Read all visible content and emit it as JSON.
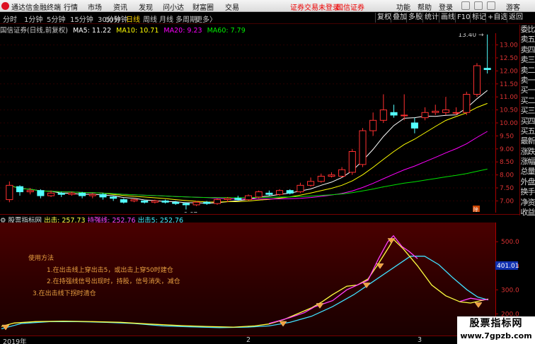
{
  "app": {
    "title": "通达信金融终端"
  },
  "menu": [
    "行情",
    "市场",
    "资讯",
    "发现",
    "问小达",
    "财富圈",
    "交易"
  ],
  "warning": "证券交易未登录",
  "broker": "国信证券",
  "right_menu": [
    "功能",
    "帮助",
    "登录",
    "游客"
  ],
  "periods": [
    "分时",
    "1分钟",
    "5分钟",
    "15分钟",
    "30分钟",
    "60分钟",
    "日线",
    "周线",
    "月线",
    "多周期",
    "更多〉"
  ],
  "active_period": "日线",
  "tools": [
    "复权",
    "叠加",
    "多股",
    "统计",
    "画线",
    "F10",
    "标记",
    "+自选",
    "返回"
  ],
  "upper": {
    "title": "国信证券(日线,前复权)",
    "ma": [
      {
        "label": "MA5: 11.22",
        "color": "#ffffff"
      },
      {
        "label": "MA10: 10.71",
        "color": "#ffff00"
      },
      {
        "label": "MA20: 9.23",
        "color": "#ff00ff"
      },
      {
        "label": "MA60: 7.79",
        "color": "#00e000"
      }
    ],
    "y_ticks": [
      "13.00",
      "12.50",
      "12.00",
      "11.50",
      "11.00",
      "10.50",
      "10.00",
      "9.50",
      "9.00",
      "8.50",
      "8.00",
      "7.50",
      "7.00"
    ],
    "high_label": "13.40",
    "low_label": "6.67",
    "side_label": "除"
  },
  "sidebar": [
    "委比",
    "卖五",
    "卖四",
    "卖三",
    "卖二",
    "卖一",
    "买一",
    "买二",
    "买三",
    "买四",
    "买五",
    "最新",
    "涨跌",
    "涨幅",
    "总量",
    "外盘",
    "换手",
    "净资",
    "收益"
  ],
  "lower": {
    "title": "股票指标网",
    "legend": [
      {
        "label": "出击: 257.73",
        "color": "#ffff40"
      },
      {
        "label": "持强线: 252.76",
        "color": "#ff40ff"
      },
      {
        "label": "出击5: 252.76",
        "color": "#40e0ff"
      }
    ],
    "y_ticks": [
      "500.0",
      "400.0",
      "300.0",
      "200.0"
    ],
    "current_value": "401.01",
    "method": [
      "使用方法",
      "1.在出击线上穿出击5，或出击上穿50时建仓",
      "2.在持强线信号出现时，持股，信号消失，减仓",
      "3.在出击线下拐时清仓"
    ]
  },
  "date_axis": [
    "2019年",
    "2",
    "3"
  ],
  "watermark": {
    "line1": "股票指标网",
    "line2": "www.7gpzb.com"
  },
  "candles": [
    {
      "o": 7.05,
      "c": 7.6,
      "h": 7.75,
      "l": 6.95
    },
    {
      "o": 7.55,
      "c": 7.35,
      "h": 7.6,
      "l": 7.2
    },
    {
      "o": 7.35,
      "c": 7.4,
      "h": 7.5,
      "l": 7.25
    },
    {
      "o": 7.4,
      "c": 7.2,
      "h": 7.45,
      "l": 7.1
    },
    {
      "o": 7.2,
      "c": 7.3,
      "h": 7.4,
      "l": 7.15
    },
    {
      "o": 7.3,
      "c": 7.25,
      "h": 7.35,
      "l": 7.15
    },
    {
      "o": 7.25,
      "c": 7.3,
      "h": 7.35,
      "l": 7.2
    },
    {
      "o": 7.3,
      "c": 7.2,
      "h": 7.35,
      "l": 7.1
    },
    {
      "o": 7.2,
      "c": 7.25,
      "h": 7.3,
      "l": 7.1
    },
    {
      "o": 7.25,
      "c": 7.15,
      "h": 7.3,
      "l": 7.05
    },
    {
      "o": 7.15,
      "c": 7.1,
      "h": 7.2,
      "l": 7.0
    },
    {
      "o": 7.05,
      "c": 6.95,
      "h": 7.1,
      "l": 6.9
    },
    {
      "o": 7.0,
      "c": 7.05,
      "h": 7.1,
      "l": 6.95
    },
    {
      "o": 7.0,
      "c": 6.95,
      "h": 7.05,
      "l": 6.9
    },
    {
      "o": 6.95,
      "c": 7.0,
      "h": 7.05,
      "l": 6.9
    },
    {
      "o": 7.0,
      "c": 6.95,
      "h": 7.05,
      "l": 6.9
    },
    {
      "o": 6.95,
      "c": 6.9,
      "h": 7.0,
      "l": 6.85
    },
    {
      "o": 6.9,
      "c": 6.85,
      "h": 6.95,
      "l": 6.67
    },
    {
      "o": 6.85,
      "c": 6.95,
      "h": 7.0,
      "l": 6.8
    },
    {
      "o": 6.95,
      "c": 6.9,
      "h": 7.0,
      "l": 6.85
    },
    {
      "o": 6.9,
      "c": 7.05,
      "h": 7.1,
      "l": 6.85
    },
    {
      "o": 7.05,
      "c": 7.1,
      "h": 7.15,
      "l": 6.95
    },
    {
      "o": 7.1,
      "c": 7.05,
      "h": 7.2,
      "l": 7.0
    },
    {
      "o": 7.05,
      "c": 7.2,
      "h": 7.25,
      "l": 7.0
    },
    {
      "o": 7.15,
      "c": 7.35,
      "h": 7.4,
      "l": 7.1
    },
    {
      "o": 7.3,
      "c": 7.25,
      "h": 7.4,
      "l": 7.2
    },
    {
      "o": 7.25,
      "c": 7.4,
      "h": 7.45,
      "l": 7.2
    },
    {
      "o": 7.4,
      "c": 7.3,
      "h": 7.45,
      "l": 7.25
    },
    {
      "o": 7.35,
      "c": 7.6,
      "h": 7.7,
      "l": 7.3
    },
    {
      "o": 7.6,
      "c": 7.75,
      "h": 7.9,
      "l": 7.55
    },
    {
      "o": 7.75,
      "c": 7.95,
      "h": 8.05,
      "l": 7.7
    },
    {
      "o": 7.95,
      "c": 8.0,
      "h": 8.1,
      "l": 7.9
    },
    {
      "o": 7.95,
      "c": 8.2,
      "h": 8.3,
      "l": 7.9
    },
    {
      "o": 8.1,
      "c": 8.9,
      "h": 9.0,
      "l": 8.0
    },
    {
      "o": 8.4,
      "c": 9.7,
      "h": 9.8,
      "l": 8.3
    },
    {
      "o": 9.7,
      "c": 10.1,
      "h": 10.4,
      "l": 9.5
    },
    {
      "o": 10.1,
      "c": 10.5,
      "h": 11.1,
      "l": 10.0
    },
    {
      "o": 10.4,
      "c": 10.3,
      "h": 10.7,
      "l": 10.2
    },
    {
      "o": 10.3,
      "c": 10.3,
      "h": 11.1,
      "l": 10.1
    },
    {
      "o": 10.0,
      "c": 9.8,
      "h": 10.2,
      "l": 9.6
    },
    {
      "o": 10.2,
      "c": 10.4,
      "h": 10.6,
      "l": 10.1
    },
    {
      "o": 10.4,
      "c": 10.45,
      "h": 10.7,
      "l": 10.3
    },
    {
      "o": 10.4,
      "c": 10.5,
      "h": 11.0,
      "l": 10.3
    },
    {
      "o": 10.4,
      "c": 10.4,
      "h": 10.6,
      "l": 10.3
    },
    {
      "o": 10.4,
      "c": 11.1,
      "h": 11.2,
      "l": 10.3
    },
    {
      "o": 11.1,
      "c": 12.2,
      "h": 12.3,
      "l": 11.0
    },
    {
      "o": 12.1,
      "c": 12.05,
      "h": 13.4,
      "l": 11.9
    }
  ]
}
